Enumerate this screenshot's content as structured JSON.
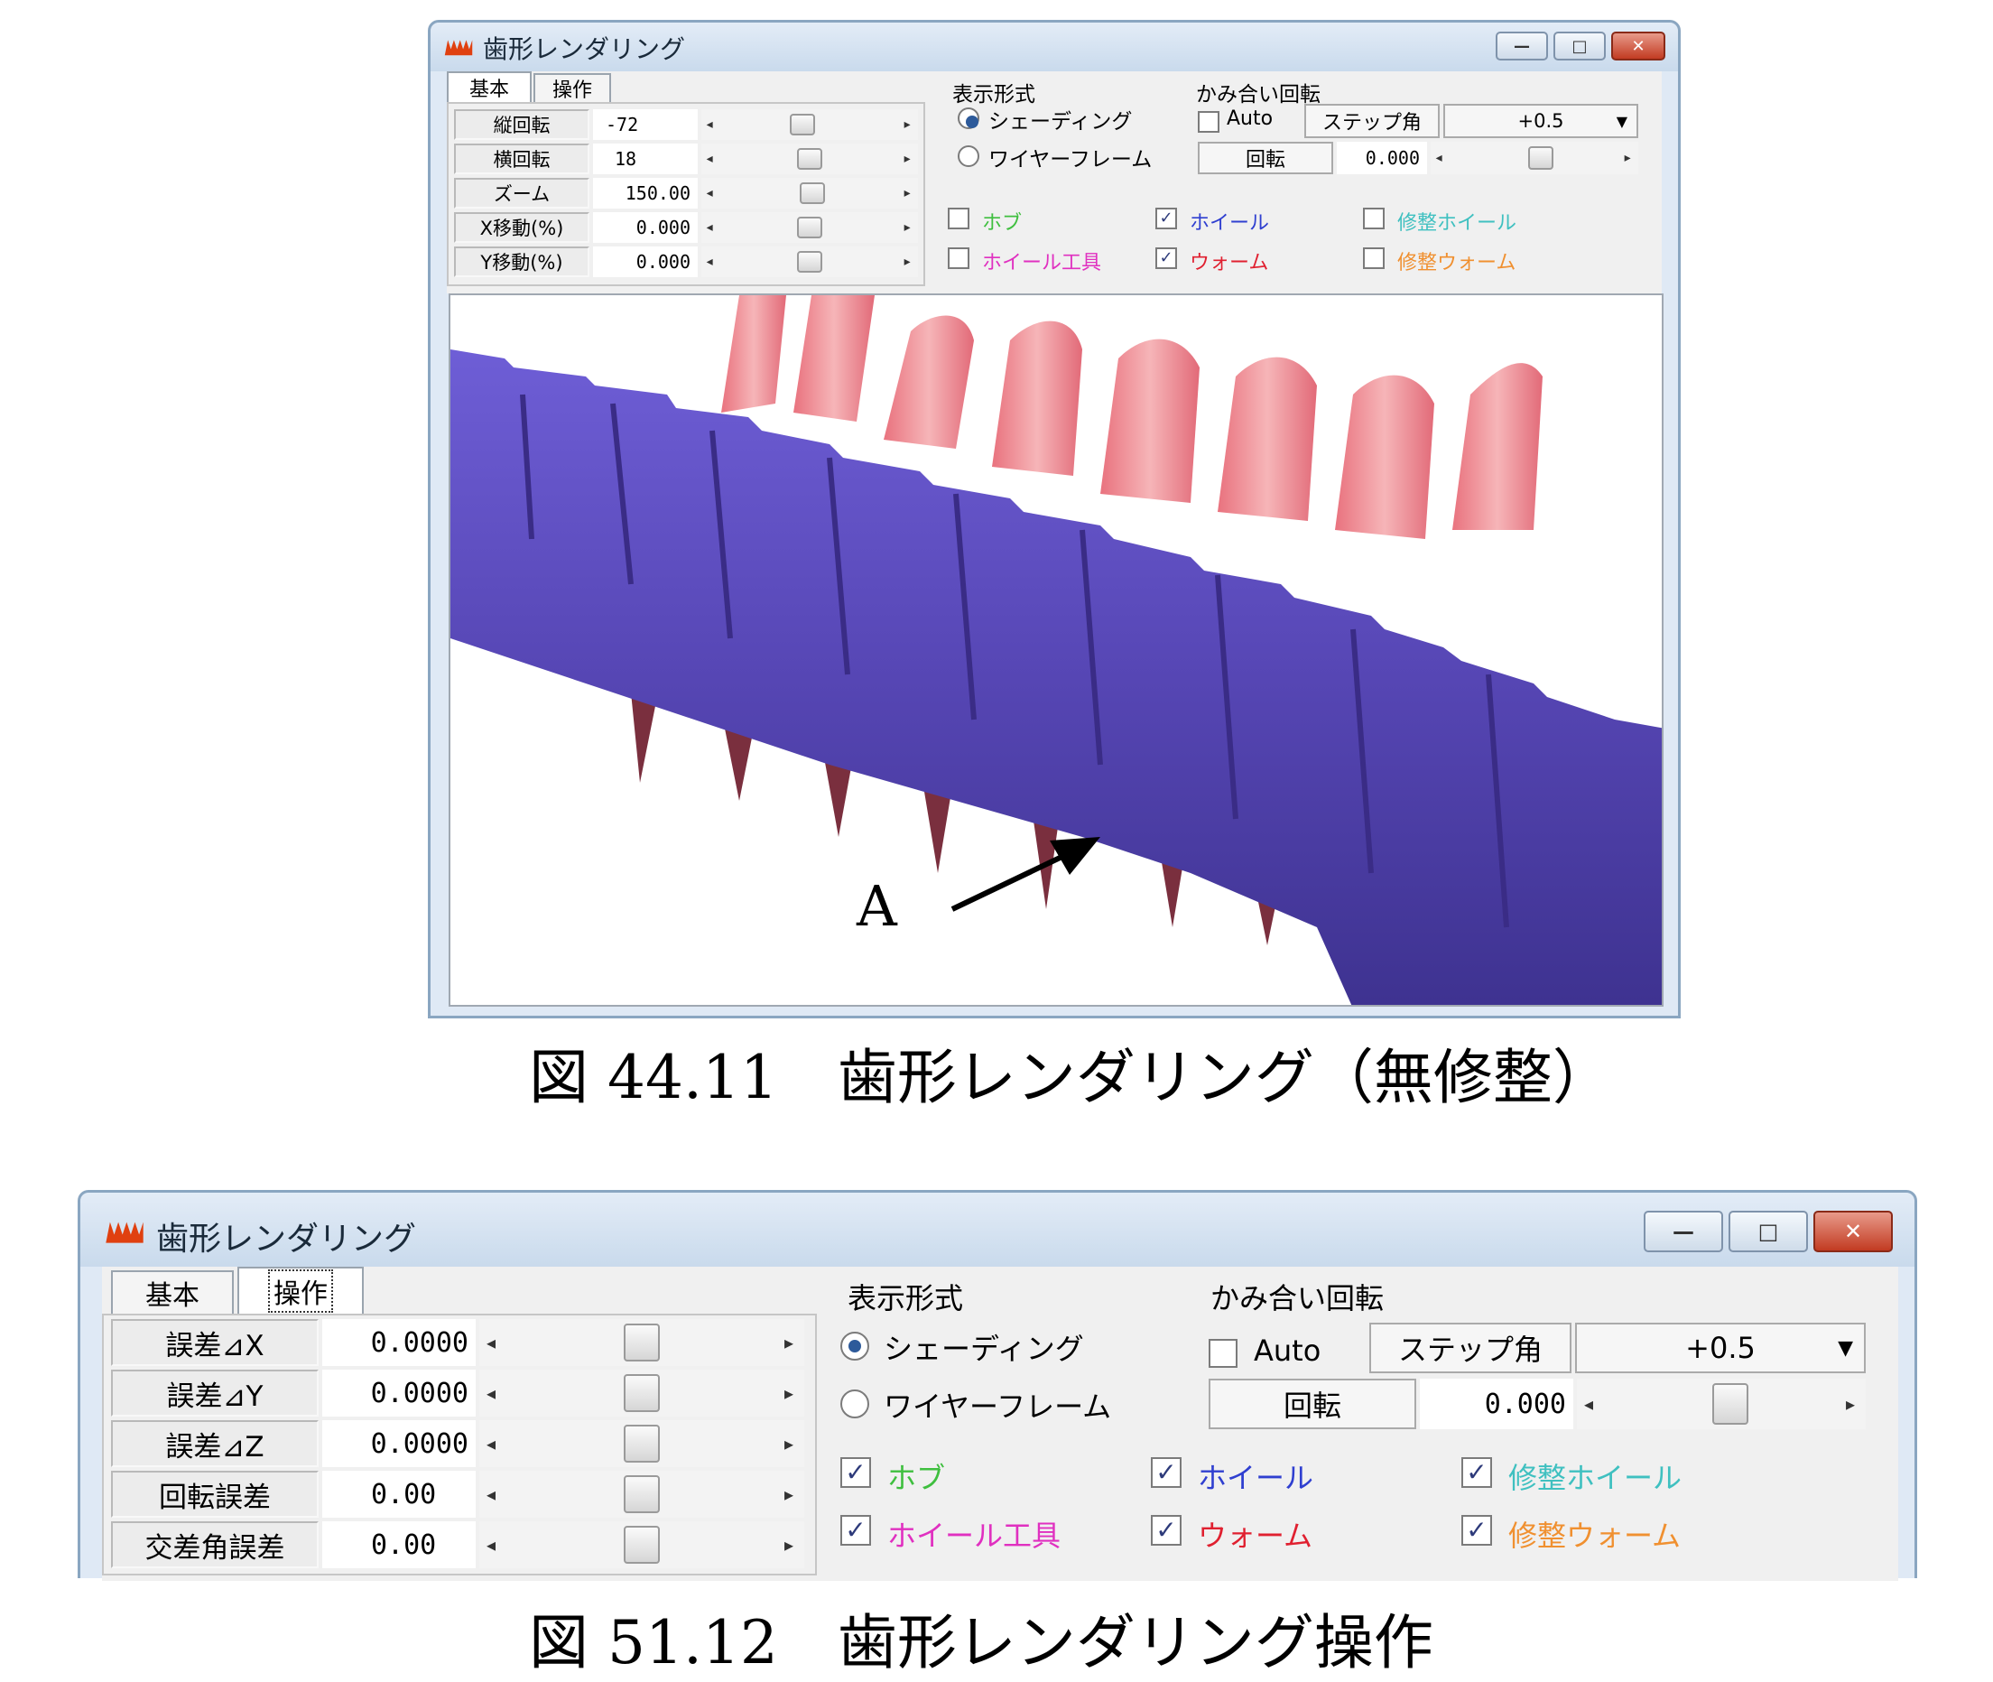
{
  "figure1": {
    "window_title": "歯形レンダリング",
    "tabs": [
      "基本",
      "操作"
    ],
    "rows": [
      {
        "label": "縦回転",
        "value": "-72",
        "slider": 0.45
      },
      {
        "label": "横回転",
        "value": "18",
        "slider": 0.5
      },
      {
        "label": "ズーム",
        "value": "150.00",
        "slider": 0.52
      },
      {
        "label": "X移動(%)",
        "value": "0.000",
        "slider": 0.5
      },
      {
        "label": "Y移動(%)",
        "value": "0.000",
        "slider": 0.5
      }
    ],
    "display_group": {
      "title": "表示形式",
      "options": [
        "シェーディング",
        "ワイヤーフレーム"
      ],
      "selected": 0
    },
    "mesh_group": {
      "title": "かみ合い回転",
      "auto_label": "Auto",
      "auto_checked": false,
      "step_label": "ステップ角",
      "step_value": "+0.5",
      "rotate_label": "回転",
      "rotate_value": "0.000"
    },
    "checkboxes": [
      {
        "label": "ホブ",
        "checked": false,
        "color": "#3fbf3f"
      },
      {
        "label": "ホイール",
        "checked": true,
        "color": "#2f3fd0"
      },
      {
        "label": "修整ホイール",
        "checked": false,
        "color": "#3fc0c0"
      },
      {
        "label": "ホイール工具",
        "checked": false,
        "color": "#e030c0"
      },
      {
        "label": "ウォーム",
        "checked": true,
        "color": "#e02030"
      },
      {
        "label": "修整ウォーム",
        "checked": false,
        "color": "#f09030"
      }
    ],
    "annotation": "A",
    "caption": "図 44.11　歯形レンダリング（無修整）"
  },
  "figure2": {
    "window_title": "歯形レンダリング",
    "tabs": [
      "基本",
      "操作"
    ],
    "rows": [
      {
        "label": "誤差⊿X",
        "value": "0.0000",
        "slider": 0.5
      },
      {
        "label": "誤差⊿Y",
        "value": "0.0000",
        "slider": 0.5
      },
      {
        "label": "誤差⊿Z",
        "value": "0.0000",
        "slider": 0.5
      },
      {
        "label": "回転誤差",
        "value": "0.00",
        "slider": 0.5
      },
      {
        "label": "交差角誤差",
        "value": "0.00",
        "slider": 0.5
      }
    ],
    "display_group": {
      "title": "表示形式",
      "options": [
        "シェーディング",
        "ワイヤーフレーム"
      ],
      "selected": 0
    },
    "mesh_group": {
      "title": "かみ合い回転",
      "auto_label": "Auto",
      "auto_checked": false,
      "step_label": "ステップ角",
      "step_value": "+0.5",
      "rotate_label": "回転",
      "rotate_value": "0.000"
    },
    "checkboxes": [
      {
        "label": "ホブ",
        "checked": true,
        "color": "#3fbf3f"
      },
      {
        "label": "ホイール",
        "checked": true,
        "color": "#2f3fd0"
      },
      {
        "label": "修整ホイール",
        "checked": true,
        "color": "#3fc0c0"
      },
      {
        "label": "ホイール工具",
        "checked": true,
        "color": "#e030c0"
      },
      {
        "label": "ウォーム",
        "checked": true,
        "color": "#e02030"
      },
      {
        "label": "修整ウォーム",
        "checked": true,
        "color": "#f09030"
      }
    ],
    "caption": "図 51.12　歯形レンダリング操作"
  },
  "window_buttons": {
    "minimize": "—",
    "maximize": "□",
    "close": "✕"
  },
  "icons": {
    "app": "gear-app-icon",
    "dropdown": "dropdown-arrow-icon",
    "slider_left": "arrow-left-icon",
    "slider_right": "arrow-right-icon"
  },
  "colors": {
    "worm": "#5848b8",
    "wheel": "#ec8a92",
    "titlebar": "#c9daec",
    "close": "#c23b22"
  }
}
